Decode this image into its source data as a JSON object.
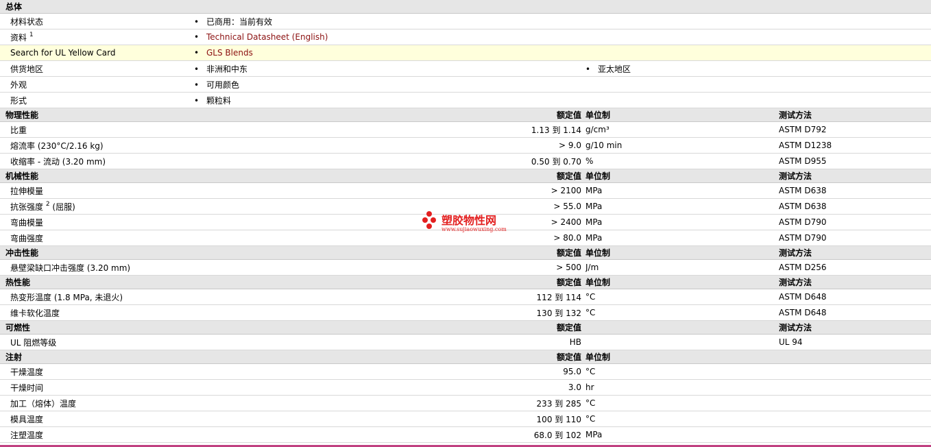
{
  "general": {
    "title": "总体",
    "rows": [
      {
        "label": "材料状态",
        "sup": "",
        "values": [
          "已商用：当前有效"
        ],
        "link": false,
        "highlight": false
      },
      {
        "label": "资料",
        "sup": "1",
        "values": [
          "Technical Datasheet (English)"
        ],
        "link": true,
        "highlight": false
      },
      {
        "label": "Search for UL Yellow Card",
        "sup": "",
        "values": [
          "GLS Blends"
        ],
        "link": true,
        "highlight": true
      },
      {
        "label": "供货地区",
        "sup": "",
        "values": [
          "非洲和中东",
          "亚太地区"
        ],
        "link": false,
        "highlight": false
      },
      {
        "label": "外观",
        "sup": "",
        "values": [
          "可用颜色"
        ],
        "link": false,
        "highlight": false
      },
      {
        "label": "形式",
        "sup": "",
        "values": [
          "颗粒料"
        ],
        "link": false,
        "highlight": false
      }
    ]
  },
  "sections": [
    {
      "title": "物理性能",
      "h_value": "额定值",
      "h_unit": "单位制",
      "h_method": "测试方法",
      "rows": [
        {
          "label": "比重",
          "value": "1.13 到  1.14",
          "unit": "g/cm³",
          "method": "ASTM D792"
        },
        {
          "label": "熔流率  (230°C/2.16 kg)",
          "value": "> 9.0",
          "unit": "g/10 min",
          "method": "ASTM D1238"
        },
        {
          "label": "收缩率  - 流动  (3.20 mm)",
          "value": "0.50 到  0.70",
          "unit": "%",
          "method": "ASTM D955"
        }
      ]
    },
    {
      "title": "机械性能",
      "h_value": "额定值",
      "h_unit": "单位制",
      "h_method": "测试方法",
      "rows": [
        {
          "label": "拉伸模量",
          "value": "> 2100",
          "unit": "MPa",
          "method": "ASTM D638"
        },
        {
          "label": "抗张强度",
          "sup": "2",
          "label_suffix": " (屈服)",
          "value": "> 55.0",
          "unit": "MPa",
          "method": "ASTM D638"
        },
        {
          "label": "弯曲模量",
          "value": "> 2400",
          "unit": "MPa",
          "method": "ASTM D790"
        },
        {
          "label": "弯曲强度",
          "value": "> 80.0",
          "unit": "MPa",
          "method": "ASTM D790"
        }
      ]
    },
    {
      "title": "冲击性能",
      "h_value": "额定值",
      "h_unit": "单位制",
      "h_method": "测试方法",
      "rows": [
        {
          "label": "悬壁梁缺口冲击强度  (3.20 mm)",
          "value": "> 500",
          "unit": "J/m",
          "method": "ASTM D256"
        }
      ]
    },
    {
      "title": "热性能",
      "h_value": "额定值",
      "h_unit": "单位制",
      "h_method": "测试方法",
      "rows": [
        {
          "label": "热变形温度  (1.8 MPa, 未退火)",
          "value": "112 到  114",
          "unit": "°C",
          "method": "ASTM D648"
        },
        {
          "label": "维卡软化温度",
          "value": "130 到  132",
          "unit": "°C",
          "method": "ASTM D648"
        }
      ]
    },
    {
      "title": "可燃性",
      "h_value": "额定值",
      "h_unit": "",
      "h_method": "测试方法",
      "rows": [
        {
          "label": "UL 阻燃等级",
          "value": "HB",
          "unit": "",
          "method": "UL 94"
        }
      ]
    },
    {
      "title": "注射",
      "h_value": "额定值",
      "h_unit": "单位制",
      "h_method": "",
      "rows": [
        {
          "label": "干燥温度",
          "value": "95.0",
          "unit": "°C",
          "method": ""
        },
        {
          "label": "干燥时间",
          "value": "3.0",
          "unit": "hr",
          "method": ""
        },
        {
          "label": "加工（熔体）温度",
          "value": "233 到  285",
          "unit": "°C",
          "method": ""
        },
        {
          "label": "模具温度",
          "value": "100 到  110",
          "unit": "°C",
          "method": ""
        },
        {
          "label": "注塑温度",
          "value": "68.0 到  102",
          "unit": "MPa",
          "method": ""
        }
      ]
    }
  ],
  "watermark": {
    "title": "塑胶物性网",
    "url": "www.sujiaowuxing.com",
    "color": "#e32020"
  }
}
